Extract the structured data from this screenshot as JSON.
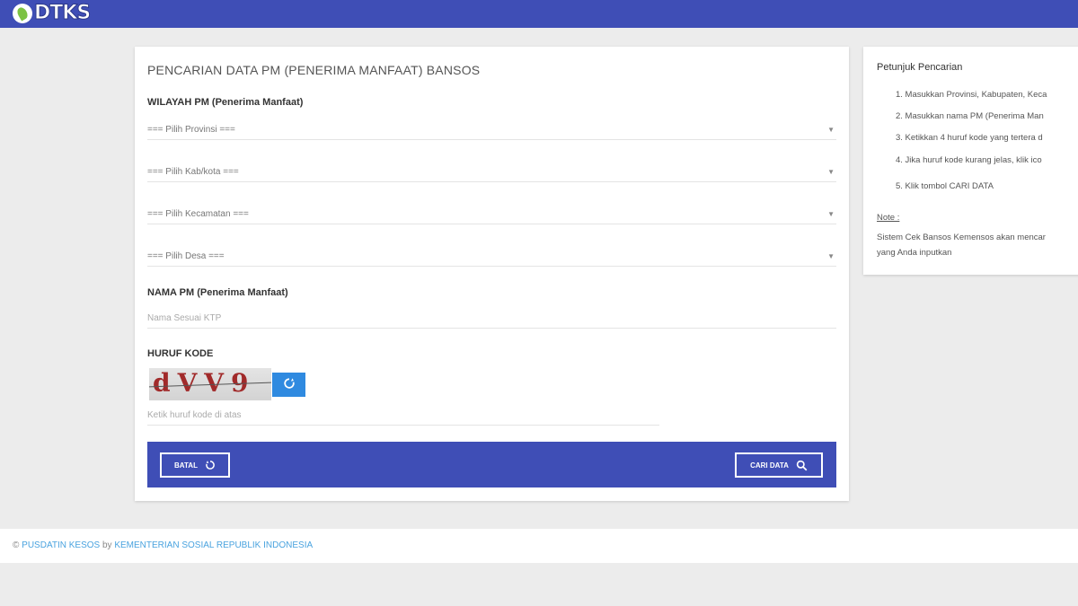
{
  "brand": {
    "logo_text": "DTKS",
    "logo_icon": "leaf-icon"
  },
  "form": {
    "title": "PENCARIAN DATA PM (PENERIMA MANFAAT) BANSOS",
    "wilayah_label": "WILAYAH PM (Penerima Manfaat)",
    "selects": {
      "provinsi": "=== Pilih Provinsi ===",
      "kabkota": "=== Pilih Kab/kota ===",
      "kecamatan": "=== Pilih Kecamatan ===",
      "desa": "=== Pilih Desa ==="
    },
    "nama_label": "NAMA PM (Penerima Manfaat)",
    "nama_placeholder": "Nama Sesuai KTP",
    "kode_label": "HURUF KODE",
    "captcha_text": "dVV9",
    "kode_placeholder": "Ketik huruf kode di atas",
    "batal_label": "BATAL",
    "cari_label": "CARI DATA"
  },
  "sidebar": {
    "title": "Petunjuk Pencarian",
    "steps": [
      "1. Masukkan Provinsi, Kabupaten, Keca",
      "2. Masukkan nama PM (Penerima Man",
      "3. Ketikkan 4 huruf kode yang tertera d",
      "4. Jika huruf kode kurang jelas, klik ico",
      "5. Klik tombol CARI DATA"
    ],
    "note_label": "Note :",
    "note_line1": "Sistem Cek Bansos Kemensos akan mencar",
    "note_line2": "yang Anda inputkan"
  },
  "footer": {
    "prefix": "©",
    "org": "PUSDATIN KESOS",
    "by": "by",
    "ministry": "KEMENTERIAN SOSIAL REPUBLIK INDONESIA"
  },
  "colors": {
    "primary": "#3f4eb6",
    "refresh": "#2f8ae0",
    "link": "#4aa3df",
    "background": "#ececec"
  }
}
